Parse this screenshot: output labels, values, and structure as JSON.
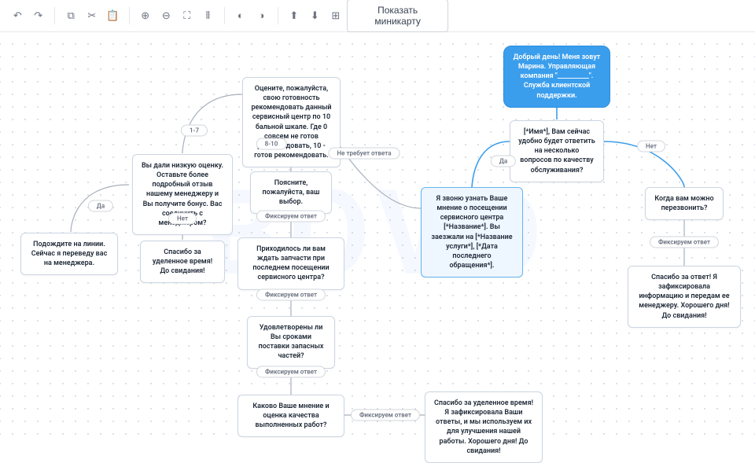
{
  "toolbar": {
    "undo": "↶",
    "redo": "↷",
    "copy": "⧉",
    "cut": "✂",
    "paste": "📋",
    "zoom_in": "⊕",
    "zoom_out": "⊖",
    "fit": "⛶",
    "align_h": "⫴",
    "fill": "◐",
    "theme": "◑",
    "tofront": "⬆",
    "toback": "⬇",
    "grid": "⊞",
    "minimap_label": "Показать миникарту"
  },
  "watermark": "BOVO",
  "nodes": {
    "start": "Добрый день! Меня зовут Марина. Управляющая компания \"__________\". Служба клиентской поддержки.",
    "q_time": "[*Имя*], Вам сейчас удобно будет ответить на несколько вопросов по качеству обслуживания?",
    "callback": "Когда вам можно перезвонить?",
    "thanks_callback": "Спасибо за ответ! Я зафиксировала информацию и передам ее менеджеру. Хорошего дня! До свидания!",
    "purpose": "Я звоню узнать Ваше мнение о посещении сервисного центра [*Название*]. Вы заезжали на [*Название услуги*], [*Дата последнего обращения*].",
    "nps": "Оцените, пожалуйста, свою готовность рекомендовать данный сервисный центр по 10 бальной шкале. Где 0 совсем не готов рекомендовать, 10 - готов рекомендовать.",
    "explain": "Поясните, пожалуйста, ваш выбор.",
    "lowscore": "Вы дали низкую оценку. Оставьте более подробный отзыв нашему менеджеру и Вы получите бонус. Вас соединить с менеджером?",
    "hold": "Подождите на линии. Сейчас я переведу вас на менеджера.",
    "bye_short": "Спасибо за уделенное время! До свидания!",
    "waitparts": "Приходилось ли вам ждать запчасти при последнем посещении сервисного центра?",
    "delivery": "Удовлетворены ли Вы сроками поставки запасных частей?",
    "quality": "Каково Ваше мнение и оценка качества выполненных работ?",
    "final": "Спасибо за уделенное время! Я зафиксировала Ваши ответы, и мы используем их для улучшения нашей работы. Хорошего дня! До свидания!"
  },
  "labels": {
    "yes": "Да",
    "no": "Нет",
    "s1_7": "1-7",
    "s8_10": "8-10",
    "noans": "Не требует ответа",
    "record": "Фиксируем ответ"
  }
}
